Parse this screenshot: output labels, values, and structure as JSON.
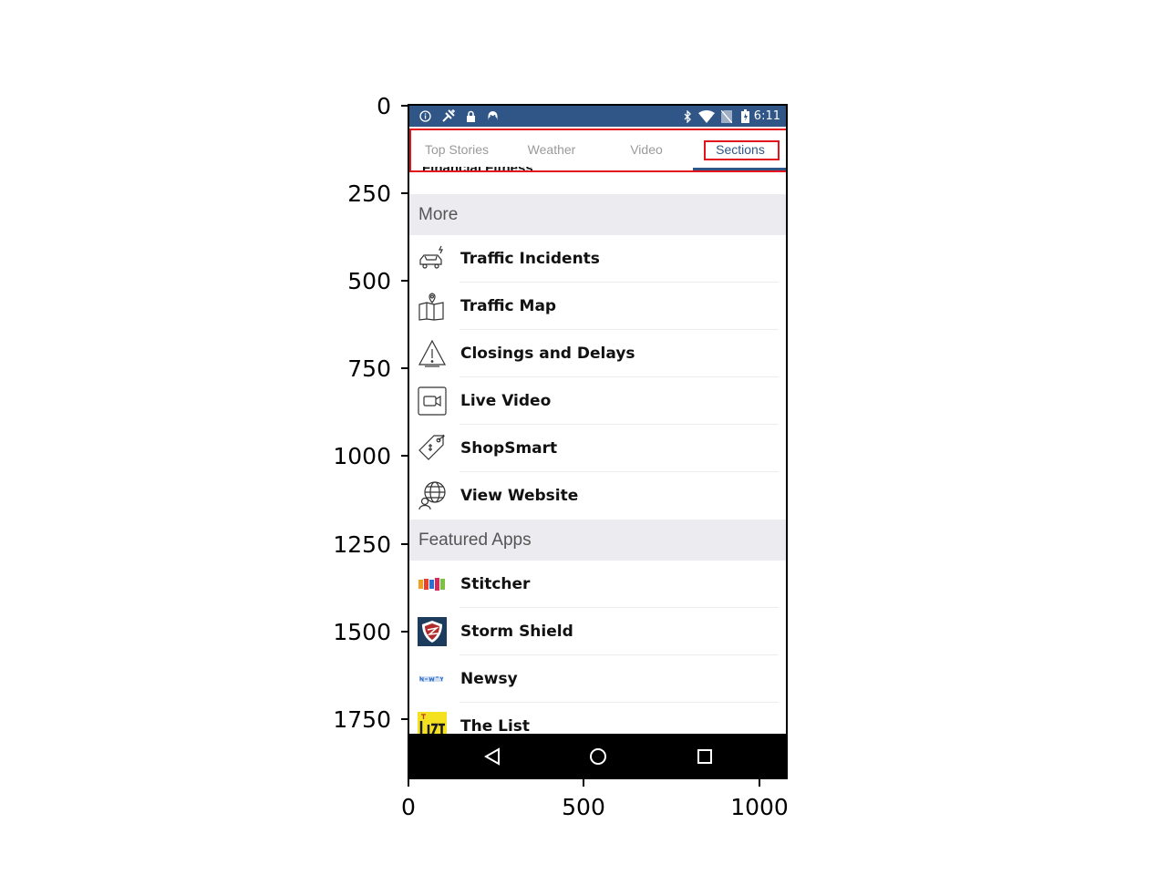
{
  "axes": {
    "y_ticks": [
      "0",
      "250",
      "500",
      "750",
      "1000",
      "1250",
      "1500",
      "1750"
    ],
    "x_ticks": [
      "0",
      "500",
      "1000"
    ]
  },
  "status_bar": {
    "time": "6:11",
    "left_icons": [
      "info-icon",
      "satellite-icon",
      "lock-icon",
      "android-icon"
    ],
    "right_icons": [
      "bluetooth-icon",
      "wifi-icon",
      "no-sim-icon",
      "battery-icon"
    ],
    "background": "#2f5687"
  },
  "tabs": [
    {
      "label": "Top Stories",
      "active": false
    },
    {
      "label": "Weather",
      "active": false
    },
    {
      "label": "Video",
      "active": false
    },
    {
      "label": "Sections",
      "active": true
    }
  ],
  "accent_color": "#2f5687",
  "highlight_color": "#e3141b",
  "cut_off_item": "Financial Fitness",
  "sections": [
    {
      "header": "More",
      "items": [
        {
          "label": "Traffic Incidents",
          "icon": "car-accident-icon"
        },
        {
          "label": "Traffic Map",
          "icon": "map-pin-icon"
        },
        {
          "label": "Closings and Delays",
          "icon": "warning-icon"
        },
        {
          "label": "Live Video",
          "icon": "video-camera-icon"
        },
        {
          "label": "ShopSmart",
          "icon": "price-tag-icon"
        },
        {
          "label": "View Website",
          "icon": "globe-icon"
        }
      ]
    },
    {
      "header": "Featured Apps",
      "items": [
        {
          "label": "Stitcher",
          "icon": "stitcher-logo-icon"
        },
        {
          "label": "Storm Shield",
          "icon": "storm-shield-logo-icon"
        },
        {
          "label": "Newsy",
          "icon": "newsy-logo-icon"
        },
        {
          "label": "The List",
          "icon": "the-list-logo-icon"
        }
      ]
    }
  ],
  "nav_bar": {
    "buttons": [
      "back-icon",
      "home-icon",
      "recents-icon"
    ]
  }
}
